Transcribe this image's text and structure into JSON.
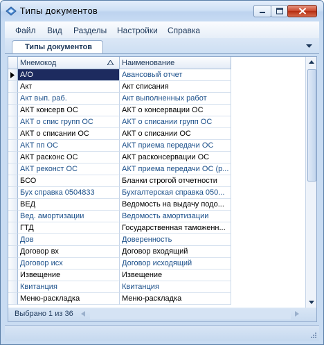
{
  "window": {
    "title": "Типы документов"
  },
  "menu": [
    "Файл",
    "Вид",
    "Разделы",
    "Настройки",
    "Справка"
  ],
  "tabs": [
    {
      "label": "Типы документов"
    }
  ],
  "table": {
    "columns": [
      "Мнемокод",
      "Наименование"
    ],
    "sort": {
      "column": "Мнемокод",
      "direction": "ascending"
    },
    "rows": [
      [
        "А/О",
        "Авансовый отчет"
      ],
      [
        "Акт",
        "Акт списания"
      ],
      [
        "Акт вып. раб.",
        "Акт выполненных работ"
      ],
      [
        "АКТ консерв ОС",
        "АКТ о консервации ОС"
      ],
      [
        "АКТ о спис групп ОС",
        "АКТ о списании групп ОС"
      ],
      [
        "АКТ о списании ОС",
        "АКТ о списании ОС"
      ],
      [
        "АКТ пп ОС",
        "АКТ приема передачи ОС"
      ],
      [
        "АКТ расконс ОС",
        "АКТ расконсервации ОС"
      ],
      [
        "АКТ реконст ОС",
        "АКТ приема передачи ОС (р..."
      ],
      [
        "БСО",
        "Бланки строгой отчетности"
      ],
      [
        "Бух справка 0504833",
        "Бухгалтерская справка 050..."
      ],
      [
        "ВЕД",
        "Ведомость на выдачу подо..."
      ],
      [
        "Вед. амортизации",
        "Ведомость амортизации"
      ],
      [
        "ГТД",
        "Государственная таможенн..."
      ],
      [
        "Дов",
        "Доверенность"
      ],
      [
        "Договор вх",
        "Договор входящий"
      ],
      [
        "Договор исх",
        "Договор исходящий"
      ],
      [
        "Извещение",
        "Извещение"
      ],
      [
        "Квитанция",
        "Квитанция"
      ],
      [
        "Меню-раскладка",
        "Меню-раскладка"
      ]
    ],
    "current_row": 0
  },
  "status": {
    "selection": "Выбрано 1 из 36"
  },
  "colors": {
    "current_row_bg": "#1d2b5f",
    "alt_text": "#1a4f8a",
    "frame": "#c9dcf2"
  },
  "icons": [
    "app-icon",
    "minimize-icon",
    "maximize-icon",
    "close-icon",
    "tab-menu-icon",
    "sort-up-icon",
    "scroll-up-icon",
    "scroll-down-icon",
    "scroll-left-icon",
    "scroll-right-icon",
    "row-indicator-icon",
    "size-grip-icon"
  ]
}
